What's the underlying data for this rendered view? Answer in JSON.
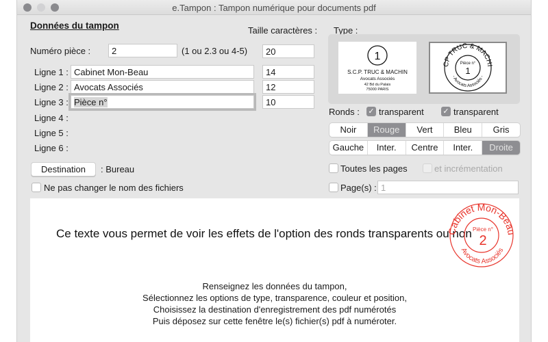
{
  "window": {
    "title": "e.Tampon : Tampon numérique pour documents pdf"
  },
  "form": {
    "heading": "Données du tampon",
    "size_header": "Taille caractères :",
    "piece_label": "Numéro pièce :",
    "piece_value": "2",
    "piece_hint": "(1 ou 2.3 ou 4-5)",
    "piece_size": "20",
    "lines": [
      {
        "label": "Ligne 1 :",
        "value": "Cabinet Mon-Beau",
        "size": "14"
      },
      {
        "label": "Ligne 2 :",
        "value": "Avocats Associés",
        "size": "12"
      },
      {
        "label": "Ligne 3 :",
        "value": "Pièce n°",
        "size": "10"
      },
      {
        "label": "Ligne 4 :"
      },
      {
        "label": "Ligne 5 :"
      },
      {
        "label": "Ligne 6 :"
      }
    ],
    "destination_button": "Destination",
    "destination_value": ":  Bureau",
    "keep_names_label": "Ne pas changer le nom des fichiers",
    "keep_names_checked": false
  },
  "type": {
    "label": "Type :",
    "option1": {
      "number": "1",
      "line1": "S.C.P. TRUC & MACHIN",
      "line2": "Avocats Associés",
      "line3": "42 Bd du Palais",
      "line4": "75000 PARIS"
    },
    "option2": {
      "outer_text": "SCP TRUC & MACHIN",
      "bottom_text": "- Avocats Associés -",
      "inner_label": "Pièce n°",
      "number": "1"
    },
    "selected": "option2"
  },
  "ronds": {
    "label": "Ronds :",
    "transparent1": {
      "label": "transparent",
      "checked": true
    },
    "transparent2": {
      "label": "transparent",
      "checked": true
    }
  },
  "colors": {
    "options": [
      "Noir",
      "Rouge",
      "Vert",
      "Bleu",
      "Gris"
    ],
    "selected": "Rouge"
  },
  "positions": {
    "options": [
      "Gauche",
      "Inter.",
      "Centre",
      "Inter.",
      "Droite"
    ],
    "selected": "Droite"
  },
  "pages": {
    "all_pages_label": "Toutes les pages",
    "all_pages_checked": false,
    "increment_label": "et incrémentation",
    "increment_enabled": false,
    "pages_label": "Page(s) :",
    "pages_checked": false,
    "pages_placeholder": "1"
  },
  "drop_area": {
    "preview_text": "Ce texte vous permet de voir les effets de l'option des ronds transparents ou non",
    "instructions": [
      "Renseignez les données du tampon,",
      "Sélectionnez les options de type, transparence, couleur et position,",
      "Choisissez la destination d'enregistrement des pdf numérotés",
      "Puis déposez sur cette fenêtre le(s) fichier(s) pdf à numéroter."
    ],
    "stamp": {
      "outer_text": "Cabinet Mon-Beau",
      "bottom_text": "Avocats Associés",
      "inner_label": "Pièce n°",
      "number": "2",
      "color": "#e8332a"
    }
  }
}
